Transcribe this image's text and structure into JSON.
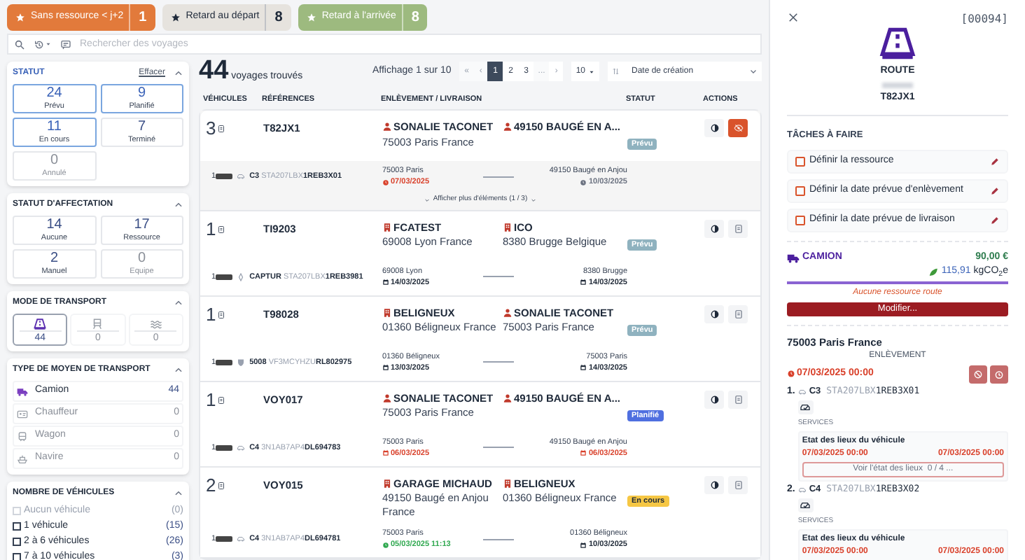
{
  "filter_buttons": [
    {
      "label": "Sans ressource < j+2",
      "count": "1",
      "kind": "alert"
    },
    {
      "label": "Retard au départ",
      "count": "8",
      "kind": "neutral"
    },
    {
      "label": "Retard à l'arrivée",
      "count": "8",
      "kind": "success"
    }
  ],
  "search": {
    "placeholder": "Rechercher des voyages"
  },
  "sidebar": {
    "status": {
      "title": "STATUT",
      "clear": "Effacer",
      "tiles": [
        {
          "count": "24",
          "label": "Prévu",
          "selected": true,
          "disabled": false
        },
        {
          "count": "9",
          "label": "Planifié",
          "selected": true,
          "disabled": false
        },
        {
          "count": "11",
          "label": "En cours",
          "selected": true,
          "disabled": false
        },
        {
          "count": "7",
          "label": "Terminé",
          "selected": false,
          "disabled": false
        },
        {
          "count": "0",
          "label": "Annulé",
          "selected": false,
          "disabled": true
        }
      ]
    },
    "assignment": {
      "title": "STATUT D'AFFECTATION",
      "tiles": [
        {
          "count": "14",
          "label": "Aucune",
          "selected": false,
          "disabled": false
        },
        {
          "count": "17",
          "label": "Ressource",
          "selected": false,
          "disabled": false
        },
        {
          "count": "2",
          "label": "Manuel",
          "selected": false,
          "disabled": false
        },
        {
          "count": "0",
          "label": "Equipe",
          "selected": false,
          "disabled": true
        }
      ]
    },
    "transport_mode": {
      "title": "MODE DE TRANSPORT",
      "tiles": [
        {
          "kind": "road",
          "count": "44",
          "selected": true,
          "disabled": false
        },
        {
          "kind": "rail",
          "count": "0",
          "selected": false,
          "disabled": true
        },
        {
          "kind": "sea",
          "count": "0",
          "selected": false,
          "disabled": true
        }
      ]
    },
    "transport_type": {
      "title": "TYPE DE MOYEN DE TRANSPORT",
      "items": [
        {
          "kind": "truck",
          "label": "Camion",
          "count": "44",
          "disabled": false
        },
        {
          "kind": "driver",
          "label": "Chauffeur",
          "count": "0",
          "disabled": true
        },
        {
          "kind": "wagon",
          "label": "Wagon",
          "count": "0",
          "disabled": true
        },
        {
          "kind": "ship",
          "label": "Navire",
          "count": "0",
          "disabled": true
        }
      ]
    },
    "vehicle_count": {
      "title": "NOMBRE DE VÉHICULES",
      "items": [
        {
          "label": "Aucun véhicule",
          "count": "(0)",
          "checked": false,
          "disabled": true
        },
        {
          "label": "1 véhicule",
          "count": "(15)",
          "checked": false,
          "disabled": false
        },
        {
          "label": "2 à 6 véhicules",
          "count": "(26)",
          "checked": false,
          "disabled": false
        },
        {
          "label": "7 à 10 véhicules",
          "count": "(3)",
          "checked": false,
          "disabled": false
        }
      ]
    }
  },
  "results": {
    "count": "44",
    "label": "voyages trouvés"
  },
  "pagination": {
    "summary": "Affichage 1 sur 10",
    "first": "«",
    "prev": "‹",
    "pages": [
      {
        "label": "1",
        "selected": true
      },
      {
        "label": "2",
        "selected": false
      },
      {
        "label": "3",
        "selected": false
      }
    ],
    "ellipsis": "...",
    "next": "›",
    "per_page": "10"
  },
  "sort": {
    "label": "Date de création"
  },
  "table": {
    "columns": [
      "VÉHICULES",
      "RÉFÉRENCES",
      "ENLÈVEMENT / LIVRAISON",
      "STATUT",
      "ACTIONS"
    ],
    "rows": [
      {
        "vehicle_count": "3",
        "reference": "T82JX1",
        "pickup": {
          "kind": "person",
          "name": "SONALIE TACONET",
          "address": "75003 Paris France"
        },
        "delivery": {
          "kind": "person",
          "name": "49150 BAUGÉ EN A..."
        },
        "status": {
          "label": "Prévu",
          "kind": "planned"
        },
        "alert": true,
        "vehicle": {
          "count": "1",
          "kind": "car",
          "model": "C3",
          "vin_prefix": "STA207LBX",
          "vin_suffix": "1REB3X01"
        },
        "from": {
          "city": "75003 Paris",
          "date": "07/03/2025",
          "kind": "clock",
          "color": "#d9412b"
        },
        "to": {
          "city": "49150 Baugé en Anjou",
          "date": "10/03/2025",
          "kind": "clock",
          "color": "#6b7280"
        },
        "more": "Afficher plus d'éléments (1 / 3)"
      },
      {
        "vehicle_count": "1",
        "reference": "TI9203",
        "pickup": {
          "kind": "building",
          "name": "FCATEST",
          "address": "69008 Lyon France"
        },
        "delivery": {
          "kind": "building",
          "name": "ICO",
          "address": "8380 Brugge Belgique"
        },
        "status": {
          "label": "Prévu",
          "kind": "planned"
        },
        "alert": false,
        "vehicle": {
          "count": "1",
          "kind": "diamond",
          "model": "CAPTUR",
          "vin_prefix": "STA207LBX",
          "vin_suffix": "1REB3981"
        },
        "from": {
          "city": "69008 Lyon",
          "date": "14/03/2025",
          "kind": "calendar",
          "color": "#1f2937"
        },
        "to": {
          "city": "8380 Brugge",
          "date": "14/03/2025",
          "kind": "calendar",
          "color": "#1f2937"
        }
      },
      {
        "vehicle_count": "1",
        "reference": "T98028",
        "pickup": {
          "kind": "building",
          "name": "BELIGNEUX",
          "address": "01360 Béligneux France"
        },
        "delivery": {
          "kind": "person",
          "name": "SONALIE TACONET",
          "address": "75003 Paris France"
        },
        "status": {
          "label": "Prévu",
          "kind": "planned"
        },
        "alert": false,
        "vehicle": {
          "count": "1",
          "kind": "shield",
          "model": "5008",
          "vin_prefix": "VF3MCYHZU",
          "vin_suffix": "RL802975"
        },
        "from": {
          "city": "01360 Béligneux",
          "date": "13/03/2025",
          "kind": "calendar",
          "color": "#1f2937"
        },
        "to": {
          "city": "75003 Paris",
          "date": "14/03/2025",
          "kind": "calendar",
          "color": "#1f2937"
        }
      },
      {
        "vehicle_count": "1",
        "reference": "VOY017",
        "pickup": {
          "kind": "person",
          "name": "SONALIE TACONET",
          "address": "75003 Paris France"
        },
        "delivery": {
          "kind": "person",
          "name": "49150 BAUGÉ EN A..."
        },
        "status": {
          "label": "Planifié",
          "kind": "scheduled"
        },
        "alert": false,
        "vehicle": {
          "count": "1",
          "kind": "car",
          "model": "C4",
          "vin_prefix": "3N1AB7AP4",
          "vin_suffix": "DL694783"
        },
        "from": {
          "city": "75003 Paris",
          "date": "06/03/2025",
          "kind": "calendar",
          "color": "#d9412b"
        },
        "to": {
          "city": "49150 Baugé en Anjou",
          "date": "06/03/2025",
          "kind": "calendar",
          "color": "#d9412b"
        }
      },
      {
        "vehicle_count": "2",
        "reference": "VOY015",
        "pickup": {
          "kind": "building",
          "name": "GARAGE MICHAUD",
          "address": "49150 Baugé en Anjou France"
        },
        "delivery": {
          "kind": "building",
          "name": "BELIGNEUX",
          "address": "01360 Béligneux France"
        },
        "status": {
          "label": "En cours",
          "kind": "in_progress"
        },
        "alert": false,
        "vehicle": {
          "count": "1",
          "kind": "car",
          "model": "C4",
          "vin_prefix": "3N1AB7AP4",
          "vin_suffix": "DL694781"
        },
        "from": {
          "city": "75003 Paris",
          "date": "05/03/2025 11:13",
          "kind": "clock",
          "color": "#2fa84f"
        },
        "to": {
          "city": "01360 Béligneux",
          "date": "10/03/2025",
          "kind": "calendar",
          "color": "#1f2937"
        }
      }
    ]
  },
  "detail": {
    "number": "[00094]",
    "mode": "ROUTE",
    "reference": "T82JX1",
    "tasks_title": "TÂCHES À FAIRE",
    "tasks": [
      {
        "label": "Définir la ressource",
        "checked": false
      },
      {
        "label": "Définir la date prévue d'enlèvement",
        "checked": false
      },
      {
        "label": "Définir la date prévue de livraison",
        "checked": false
      }
    ],
    "resource": {
      "label": "CAMION",
      "price": "90,00 €",
      "emission": "115,91",
      "emission_unit": "kgCO$_{2}$e",
      "warning": "Aucune ressource route",
      "button": "Modifier..."
    },
    "stop": {
      "place": "75003 Paris France",
      "type": "ENLÈVEMENT",
      "date": "07/03/2025 00:00",
      "vehicles": [
        {
          "index": "1.",
          "model": "C3",
          "vin_prefix": "STA207LBX",
          "vin_suffix": "1REB3X01",
          "services_label": "SERVICES",
          "service": {
            "title": "Etat des lieux du véhicule",
            "start": "07/03/2025 00:00",
            "end": "07/03/2025 00:00",
            "link": "Voir l'état des lieux  0 / 4 ..."
          }
        },
        {
          "index": "2.",
          "model": "C4",
          "vin_prefix": "STA207LBX",
          "vin_suffix": "1REB3X02",
          "services_label": "SERVICES",
          "service": {
            "title": "Etat des lieux du véhicule",
            "start": "07/03/2025 00:00",
            "end": "07/03/2025 00:00"
          }
        }
      ]
    }
  }
}
